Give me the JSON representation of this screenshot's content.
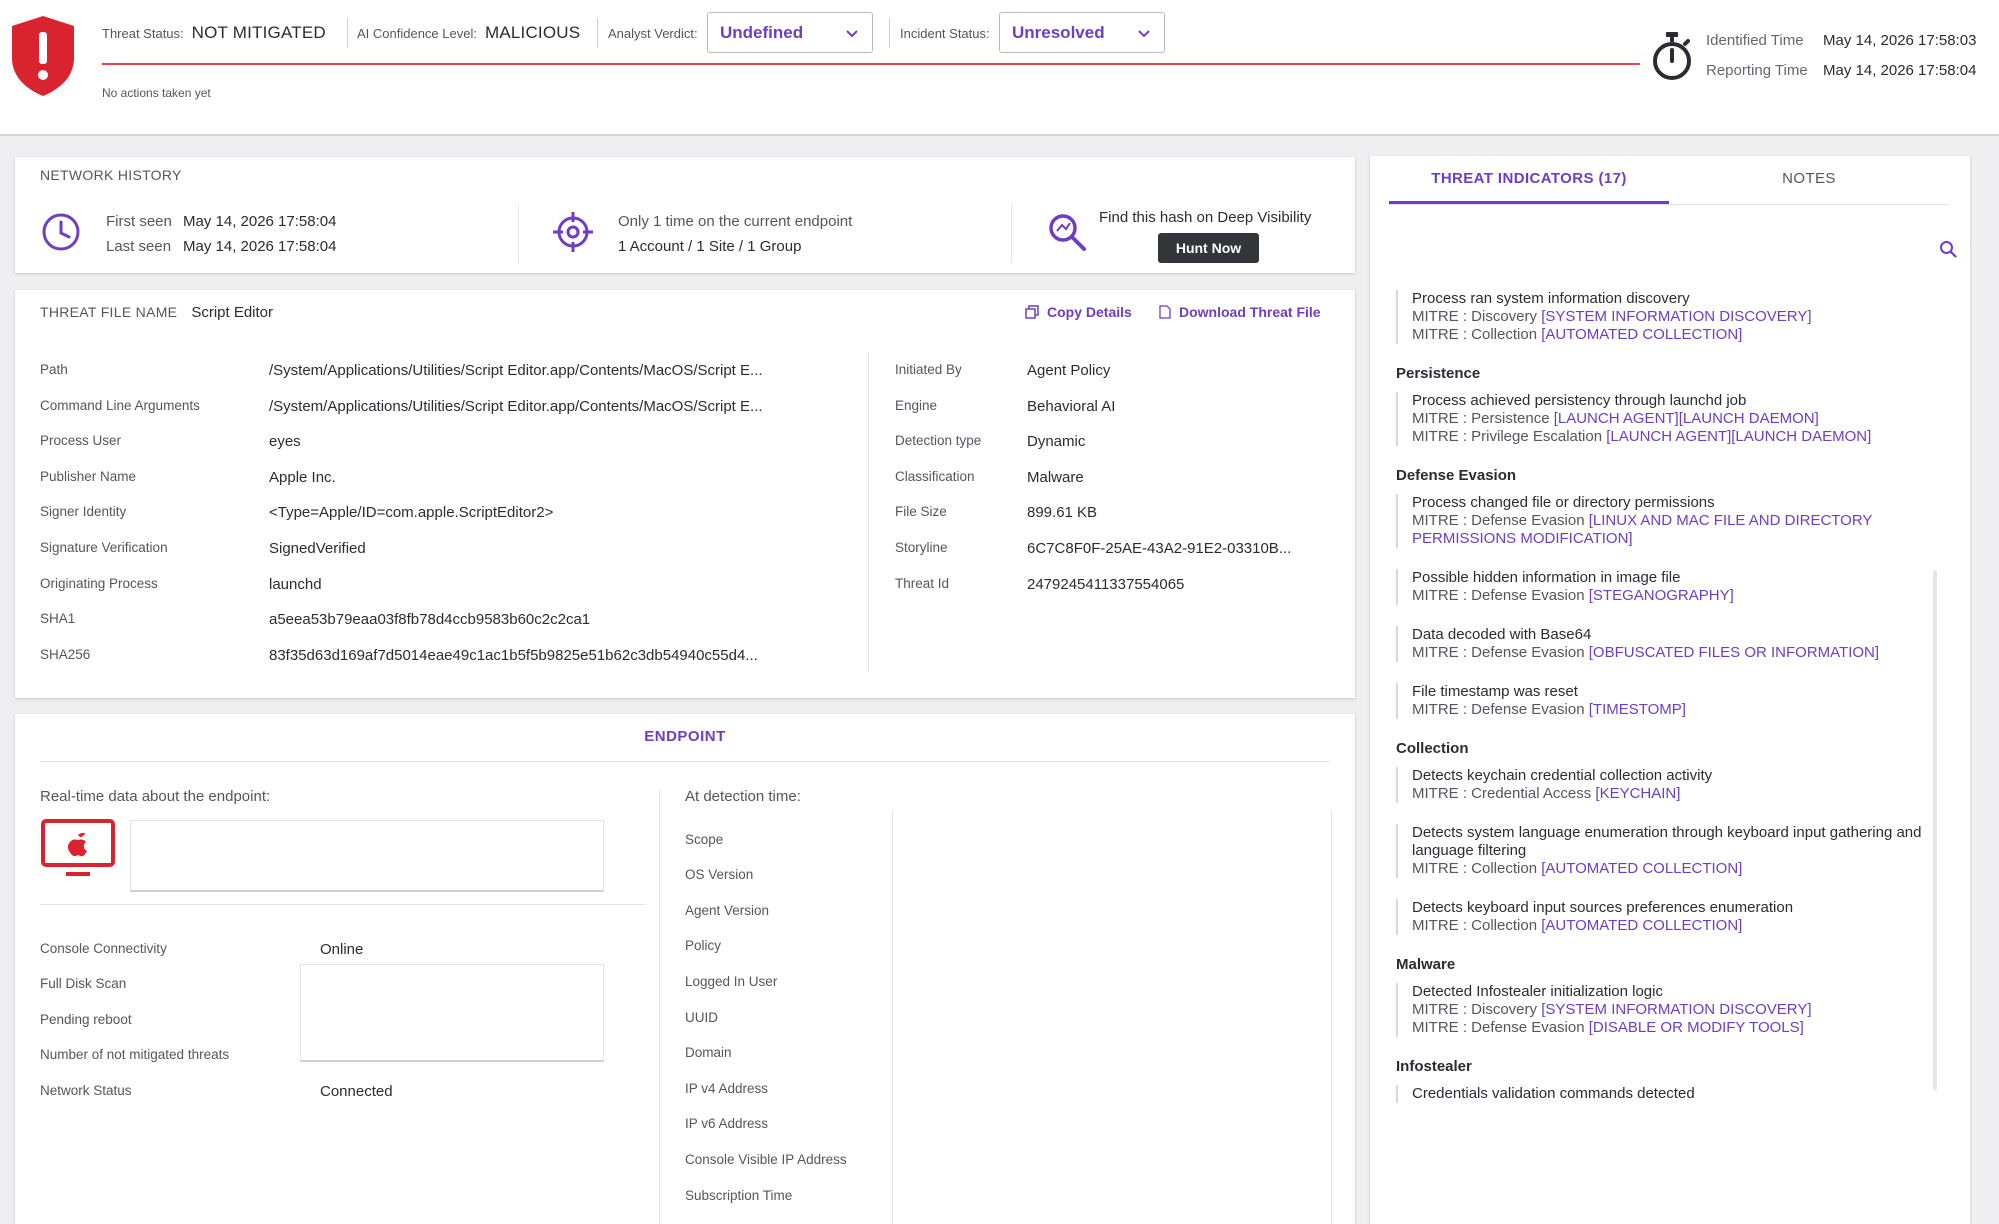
{
  "header": {
    "threat_status_label": "Threat Status:",
    "threat_status_value": "NOT MITIGATED",
    "ai_confidence_label": "AI Confidence Level:",
    "ai_confidence_value": "MALICIOUS",
    "analyst_verdict_label": "Analyst Verdict:",
    "analyst_verdict_value": "Undefined",
    "incident_status_label": "Incident Status:",
    "incident_status_value": "Unresolved",
    "actions_note": "No actions taken yet",
    "identified_label": "Identified Time",
    "identified_value": "May 14, 2026 17:58:03",
    "reporting_label": "Reporting Time",
    "reporting_value": "May 14, 2026 17:58:04"
  },
  "network_history": {
    "title": "NETWORK HISTORY",
    "first_seen_label": "First seen",
    "first_seen_value": "May 14, 2026 17:58:04",
    "last_seen_label": "Last seen",
    "last_seen_value": "May 14, 2026 17:58:04",
    "occurrence": "Only 1 time on the current endpoint",
    "scope": "1 Account / 1 Site / 1 Group",
    "deep_visibility": "Find this hash on Deep Visibility",
    "hunt_now": "Hunt Now"
  },
  "threat_file": {
    "label": "THREAT FILE NAME",
    "name": "Script Editor",
    "copy_details": "Copy Details",
    "download": "Download Threat File",
    "left_fields": [
      {
        "k": "Path",
        "v": "/System/Applications/Utilities/Script Editor.app/Contents/MacOS/Script E..."
      },
      {
        "k": "Command Line Arguments",
        "v": "/System/Applications/Utilities/Script Editor.app/Contents/MacOS/Script E..."
      },
      {
        "k": "Process User",
        "v": "eyes"
      },
      {
        "k": "Publisher Name",
        "v": "Apple Inc."
      },
      {
        "k": "Signer Identity",
        "v": "<Type=Apple/ID=com.apple.ScriptEditor2>"
      },
      {
        "k": "Signature Verification",
        "v": "SignedVerified"
      },
      {
        "k": "Originating Process",
        "v": "launchd"
      },
      {
        "k": "SHA1",
        "v": "a5eea53b79eaa03f8fb78d4ccb9583b60c2c2ca1"
      },
      {
        "k": "SHA256",
        "v": "83f35d63d169af7d5014eae49c1ac1b5f5b9825e51b62c3db54940c55d4..."
      }
    ],
    "right_fields": [
      {
        "k": "Initiated By",
        "v": "Agent Policy"
      },
      {
        "k": "Engine",
        "v": "Behavioral AI"
      },
      {
        "k": "Detection type",
        "v": "Dynamic"
      },
      {
        "k": "Classification",
        "v": "Malware"
      },
      {
        "k": "File Size",
        "v": "899.61 KB"
      },
      {
        "k": "Storyline",
        "v": "6C7C8F0F-25AE-43A2-91E2-03310B..."
      },
      {
        "k": "Threat Id",
        "v": "2479245411337554065"
      }
    ]
  },
  "endpoint": {
    "title": "ENDPOINT",
    "realtime_label": "Real-time data about the endpoint:",
    "detection_label": "At detection time:",
    "left_fields": [
      {
        "k": "Console Connectivity",
        "v": "Online"
      },
      {
        "k": "Full Disk Scan",
        "v": ""
      },
      {
        "k": "Pending reboot",
        "v": ""
      },
      {
        "k": "Number of not mitigated threats",
        "v": ""
      },
      {
        "k": "Network Status",
        "v": "Connected"
      }
    ],
    "right_fields": [
      "Scope",
      "OS Version",
      "Agent Version",
      "Policy",
      "Logged In User",
      "UUID",
      "Domain",
      "IP v4 Address",
      "IP v6 Address",
      "Console Visible IP Address",
      "Subscription Time"
    ]
  },
  "threat_indicators": {
    "tab_indicators": "THREAT INDICATORS (17)",
    "tab_notes": "NOTES",
    "groups": [
      {
        "name": "",
        "items": [
          {
            "title": "Process ran system information discovery",
            "mitre": [
              {
                "pre": "MITRE : Discovery ",
                "tag": "[SYSTEM INFORMATION DISCOVERY]"
              },
              {
                "pre": "MITRE : Collection ",
                "tag": "[AUTOMATED COLLECTION]"
              }
            ]
          }
        ]
      },
      {
        "name": "Persistence",
        "items": [
          {
            "title": "Process achieved persistency through launchd job",
            "mitre": [
              {
                "pre": "MITRE : Persistence ",
                "tag": "[LAUNCH AGENT][LAUNCH DAEMON]"
              },
              {
                "pre": "MITRE : Privilege Escalation ",
                "tag": "[LAUNCH AGENT][LAUNCH DAEMON]"
              }
            ]
          }
        ]
      },
      {
        "name": "Defense Evasion",
        "items": [
          {
            "title": "Process changed file or directory permissions",
            "mitre": [
              {
                "pre": "MITRE : Defense Evasion ",
                "tag": "[LINUX AND MAC FILE AND DIRECTORY PERMISSIONS MODIFICATION]"
              }
            ]
          },
          {
            "title": "Possible hidden information in image file",
            "mitre": [
              {
                "pre": "MITRE : Defense Evasion ",
                "tag": "[STEGANOGRAPHY]"
              }
            ]
          },
          {
            "title": "Data decoded with Base64",
            "mitre": [
              {
                "pre": "MITRE : Defense Evasion ",
                "tag": "[OBFUSCATED FILES OR INFORMATION]"
              }
            ]
          },
          {
            "title": "File timestamp was reset",
            "mitre": [
              {
                "pre": "MITRE : Defense Evasion ",
                "tag": "[TIMESTOMP]"
              }
            ]
          }
        ]
      },
      {
        "name": "Collection",
        "items": [
          {
            "title": "Detects keychain credential collection activity",
            "mitre": [
              {
                "pre": "MITRE : Credential Access ",
                "tag": "[KEYCHAIN]"
              }
            ]
          },
          {
            "title": "Detects system language enumeration through keyboard input gathering and language filtering",
            "mitre": [
              {
                "pre": "MITRE : Collection ",
                "tag": "[AUTOMATED COLLECTION]"
              }
            ]
          },
          {
            "title": "Detects keyboard input sources preferences enumeration",
            "mitre": [
              {
                "pre": "MITRE : Collection ",
                "tag": "[AUTOMATED COLLECTION]"
              }
            ]
          }
        ]
      },
      {
        "name": "Malware",
        "items": [
          {
            "title": "Detected Infostealer initialization logic",
            "mitre": [
              {
                "pre": "MITRE : Discovery ",
                "tag": "[SYSTEM INFORMATION DISCOVERY]"
              },
              {
                "pre": "MITRE : Defense Evasion ",
                "tag": "[DISABLE OR MODIFY TOOLS]"
              }
            ]
          }
        ]
      },
      {
        "name": "Infostealer",
        "items": [
          {
            "title": "Credentials validation commands detected",
            "mitre": []
          }
        ]
      }
    ]
  },
  "icons": {
    "alert": "shield-alert-icon",
    "timer": "stopwatch-icon",
    "clock": "clock-icon",
    "target": "target-icon",
    "hunt": "search-hash-icon",
    "endpoint": "apple-monitor-icon"
  },
  "colors": {
    "accent": "#6d3fc0",
    "danger": "#d9232f",
    "status_line": "#e0454d"
  }
}
